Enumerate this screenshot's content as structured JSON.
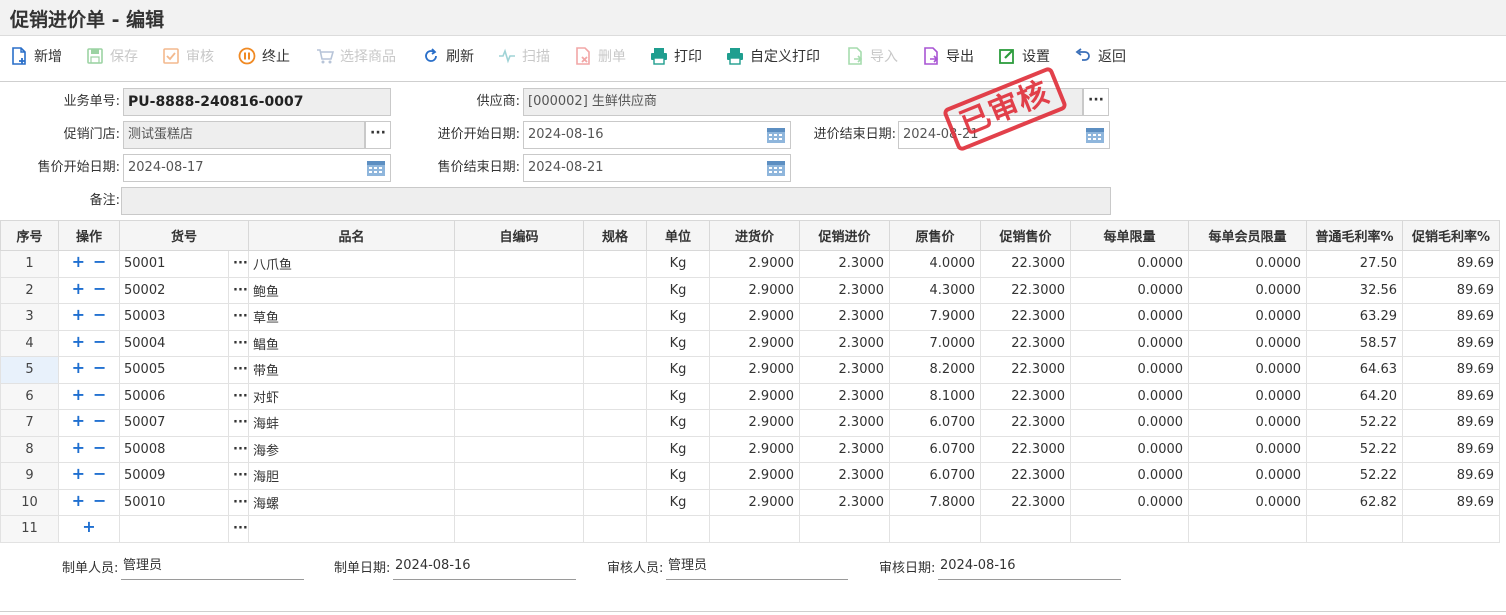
{
  "window": {
    "title": "促销进价单 - 编辑"
  },
  "toolbar": {
    "new": "新增",
    "save": "保存",
    "audit": "审核",
    "terminate": "终止",
    "select_goods": "选择商品",
    "refresh": "刷新",
    "scan": "扫描",
    "delete": "删单",
    "print": "打印",
    "custom_print": "自定义打印",
    "import": "导入",
    "export": "导出",
    "settings": "设置",
    "back": "返回"
  },
  "form": {
    "order_no_label": "业务单号:",
    "order_no": "PU-8888-240816-0007",
    "supplier_label": "供应商:",
    "supplier": "[000002] 生鲜供应商",
    "store_label": "促销门店:",
    "store": "测试蛋糕店",
    "purchase_start_label": "进价开始日期:",
    "purchase_start": "2024-08-16",
    "purchase_end_label": "进价结束日期:",
    "purchase_end": "2024-08-21",
    "sale_start_label": "售价开始日期:",
    "sale_start": "2024-08-17",
    "sale_end_label": "售价结束日期:",
    "sale_end": "2024-08-21",
    "remark_label": "备注:",
    "remark": ""
  },
  "stamp": {
    "text": "已审核",
    "color": "#e0313c"
  },
  "grid": {
    "headers": [
      "序号",
      "操作",
      "货号",
      "品名",
      "自编码",
      "规格",
      "单位",
      "进货价",
      "促销进价",
      "原售价",
      "促销售价",
      "每单限量",
      "每单会员限量",
      "普通毛利率%",
      "促销毛利率%"
    ],
    "rows": [
      {
        "seq": "1",
        "code": "50001",
        "name": "八爪鱼",
        "unit": "Kg",
        "cost": "2.9000",
        "promo_cost": "2.3000",
        "price": "4.0000",
        "promo_price": "22.3000",
        "limit": "0.0000",
        "member_limit": "0.0000",
        "margin": "27.50",
        "promo_margin": "89.69"
      },
      {
        "seq": "2",
        "code": "50002",
        "name": "鲍鱼",
        "unit": "Kg",
        "cost": "2.9000",
        "promo_cost": "2.3000",
        "price": "4.3000",
        "promo_price": "22.3000",
        "limit": "0.0000",
        "member_limit": "0.0000",
        "margin": "32.56",
        "promo_margin": "89.69"
      },
      {
        "seq": "3",
        "code": "50003",
        "name": "草鱼",
        "unit": "Kg",
        "cost": "2.9000",
        "promo_cost": "2.3000",
        "price": "7.9000",
        "promo_price": "22.3000",
        "limit": "0.0000",
        "member_limit": "0.0000",
        "margin": "63.29",
        "promo_margin": "89.69"
      },
      {
        "seq": "4",
        "code": "50004",
        "name": "鲳鱼",
        "unit": "Kg",
        "cost": "2.9000",
        "promo_cost": "2.3000",
        "price": "7.0000",
        "promo_price": "22.3000",
        "limit": "0.0000",
        "member_limit": "0.0000",
        "margin": "58.57",
        "promo_margin": "89.69"
      },
      {
        "seq": "5",
        "code": "50005",
        "name": "带鱼",
        "unit": "Kg",
        "cost": "2.9000",
        "promo_cost": "2.3000",
        "price": "8.2000",
        "promo_price": "22.3000",
        "limit": "0.0000",
        "member_limit": "0.0000",
        "margin": "64.63",
        "promo_margin": "89.69"
      },
      {
        "seq": "6",
        "code": "50006",
        "name": "对虾",
        "unit": "Kg",
        "cost": "2.9000",
        "promo_cost": "2.3000",
        "price": "8.1000",
        "promo_price": "22.3000",
        "limit": "0.0000",
        "member_limit": "0.0000",
        "margin": "64.20",
        "promo_margin": "89.69"
      },
      {
        "seq": "7",
        "code": "50007",
        "name": "海蚌",
        "unit": "Kg",
        "cost": "2.9000",
        "promo_cost": "2.3000",
        "price": "6.0700",
        "promo_price": "22.3000",
        "limit": "0.0000",
        "member_limit": "0.0000",
        "margin": "52.22",
        "promo_margin": "89.69"
      },
      {
        "seq": "8",
        "code": "50008",
        "name": "海参",
        "unit": "Kg",
        "cost": "2.9000",
        "promo_cost": "2.3000",
        "price": "6.0700",
        "promo_price": "22.3000",
        "limit": "0.0000",
        "member_limit": "0.0000",
        "margin": "52.22",
        "promo_margin": "89.69"
      },
      {
        "seq": "9",
        "code": "50009",
        "name": "海胆",
        "unit": "Kg",
        "cost": "2.9000",
        "promo_cost": "2.3000",
        "price": "6.0700",
        "promo_price": "22.3000",
        "limit": "0.0000",
        "member_limit": "0.0000",
        "margin": "52.22",
        "promo_margin": "89.69"
      },
      {
        "seq": "10",
        "code": "50010",
        "name": "海螺",
        "unit": "Kg",
        "cost": "2.9000",
        "promo_cost": "2.3000",
        "price": "7.8000",
        "promo_price": "22.3000",
        "limit": "0.0000",
        "member_limit": "0.0000",
        "margin": "62.82",
        "promo_margin": "89.69"
      },
      {
        "seq": "11",
        "code": "",
        "name": "",
        "unit": "",
        "cost": "",
        "promo_cost": "",
        "price": "",
        "promo_price": "",
        "limit": "",
        "member_limit": "",
        "margin": "",
        "promo_margin": ""
      }
    ]
  },
  "footer": {
    "creator_label": "制单人员:",
    "creator": "管理员",
    "created_label": "制单日期:",
    "created": "2024-08-16",
    "auditor_label": "审核人员:",
    "auditor": "管理员",
    "audited_label": "审核日期:",
    "audited": "2024-08-16"
  }
}
